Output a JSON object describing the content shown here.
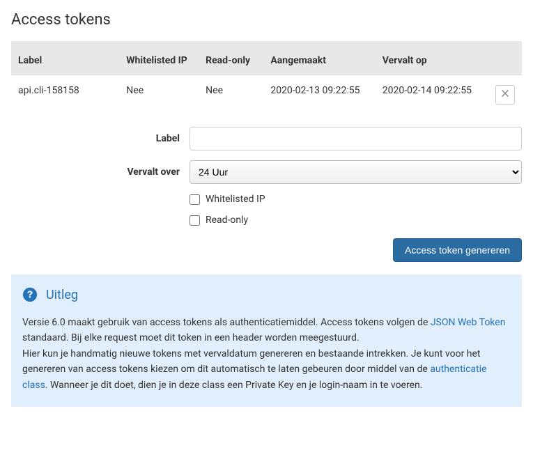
{
  "title": "Access tokens",
  "table": {
    "headers": {
      "label": "Label",
      "whitelisted_ip": "Whitelisted IP",
      "read_only": "Read-only",
      "created": "Aangemaakt",
      "expires": "Vervalt op",
      "actions": ""
    },
    "rows": [
      {
        "label": "api.cli-158158",
        "whitelisted_ip": "Nee",
        "read_only": "Nee",
        "created": "2020-02-13 09:22:55",
        "expires": "2020-02-14 09:22:55"
      }
    ]
  },
  "form": {
    "label_label": "Label",
    "label_value": "",
    "expires_label": "Vervalt over",
    "expires_value": "24 Uur",
    "whitelisted_ip_label": "Whitelisted IP",
    "read_only_label": "Read-only",
    "submit_label": "Access token genereren"
  },
  "info": {
    "title": "Uitleg",
    "text_1": "Versie 6.0 maakt gebruik van access tokens als authenticatiemiddel. Access tokens volgen de ",
    "link_1": "JSON Web Token",
    "text_2": " standaard. Bij elke request moet dit token in een header worden meegestuurd.",
    "text_3": "Hier kun je handmatig nieuwe tokens met vervaldatum genereren en bestaande intrekken. Je kunt voor het genereren van access tokens kiezen om dit automatisch te laten gebeuren door middel van de ",
    "link_2": "authenticatie class",
    "text_4": ". Wanneer je dit doet, dien je in deze class een Private Key en je login-naam in te voeren."
  }
}
